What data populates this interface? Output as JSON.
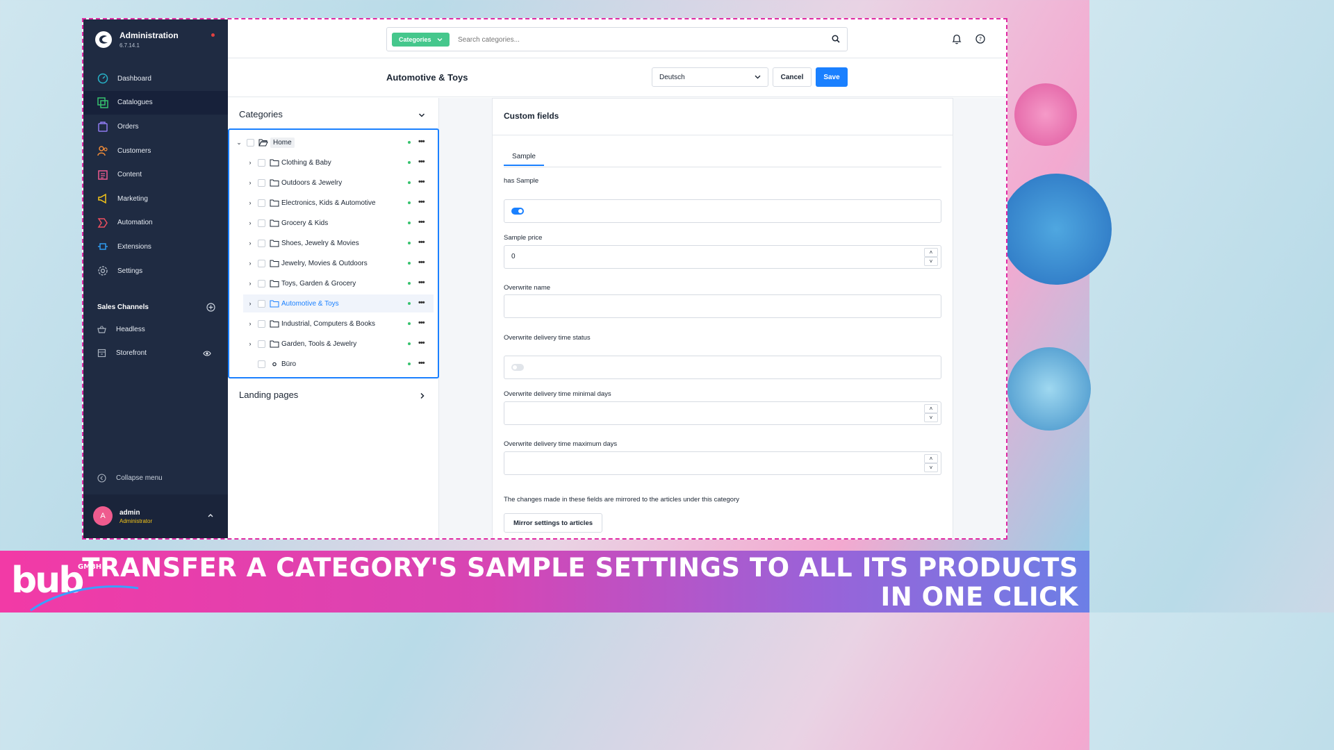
{
  "app": {
    "title": "Administration",
    "version": "6.7.14.1"
  },
  "nav": [
    {
      "label": "Dashboard",
      "icon": "dashboard-icon",
      "color": "#27b4c9"
    },
    {
      "label": "Catalogues",
      "icon": "catalogues-icon",
      "color": "#37c26e"
    },
    {
      "label": "Orders",
      "icon": "orders-icon",
      "color": "#8e7bf0"
    },
    {
      "label": "Customers",
      "icon": "customers-icon",
      "color": "#f28c38"
    },
    {
      "label": "Content",
      "icon": "content-icon",
      "color": "#ef5b8e"
    },
    {
      "label": "Marketing",
      "icon": "marketing-icon",
      "color": "#f5c518"
    },
    {
      "label": "Automation",
      "icon": "automation-icon",
      "color": "#ef4f5f"
    },
    {
      "label": "Extensions",
      "icon": "extensions-icon",
      "color": "#2f9bf0"
    },
    {
      "label": "Settings",
      "icon": "settings-icon",
      "color": "#aab3c0"
    }
  ],
  "sales_channels": {
    "title": "Sales Channels",
    "items": [
      {
        "label": "Headless"
      },
      {
        "label": "Storefront"
      }
    ]
  },
  "collapse_label": "Collapse menu",
  "user": {
    "initial": "A",
    "name": "admin",
    "role": "Administrator"
  },
  "search": {
    "pill": "Categories",
    "placeholder": "Search categories..."
  },
  "header": {
    "title": "Automotive & Toys",
    "language": "Deutsch",
    "cancel": "Cancel",
    "save": "Save"
  },
  "categories": {
    "title": "Categories",
    "tree": [
      {
        "label": "Home",
        "expanded": true,
        "level": 0,
        "type": "folder-open"
      },
      {
        "label": "Clothing & Baby",
        "level": 1,
        "type": "folder"
      },
      {
        "label": "Outdoors & Jewelry",
        "level": 1,
        "type": "folder"
      },
      {
        "label": "Electronics, Kids & Automotive",
        "level": 1,
        "type": "folder"
      },
      {
        "label": "Grocery & Kids",
        "level": 1,
        "type": "folder"
      },
      {
        "label": "Shoes, Jewelry & Movies",
        "level": 1,
        "type": "folder"
      },
      {
        "label": "Jewelry, Movies & Outdoors",
        "level": 1,
        "type": "folder"
      },
      {
        "label": "Toys, Garden & Grocery",
        "level": 1,
        "type": "folder"
      },
      {
        "label": "Automotive & Toys",
        "level": 1,
        "type": "folder",
        "selected": true
      },
      {
        "label": "Industrial, Computers & Books",
        "level": 1,
        "type": "folder"
      },
      {
        "label": "Garden, Tools & Jewelry",
        "level": 1,
        "type": "folder"
      },
      {
        "label": "Büro",
        "level": 1,
        "type": "leaf"
      }
    ],
    "landing_title": "Landing pages"
  },
  "custom_fields": {
    "title": "Custom fields",
    "tab": "Sample",
    "has_sample_label": "has Sample",
    "has_sample": true,
    "sample_price_label": "Sample price",
    "sample_price": "0",
    "overwrite_name_label": "Overwrite name",
    "overwrite_name": "",
    "overwrite_delivery_status_label": "Overwrite delivery time status",
    "overwrite_delivery_status": false,
    "min_days_label": "Overwrite delivery time minimal days",
    "max_days_label": "Overwrite delivery time maximum days",
    "note": "The changes made in these fields are mirrored to the articles under this category",
    "mirror_button": "Mirror settings to articles"
  },
  "banner": {
    "logo_text": "bub",
    "logo_sub": "GMBH",
    "line1": "TRANSFER A CATEGORY'S SAMPLE SETTINGS TO ALL ITS PRODUCTS",
    "line2": "IN ONE CLICK"
  },
  "colors": {
    "accent": "#1a80ff",
    "sidebar": "#1f2b42",
    "pill": "#45c78c",
    "frame": "#e02aa4"
  }
}
